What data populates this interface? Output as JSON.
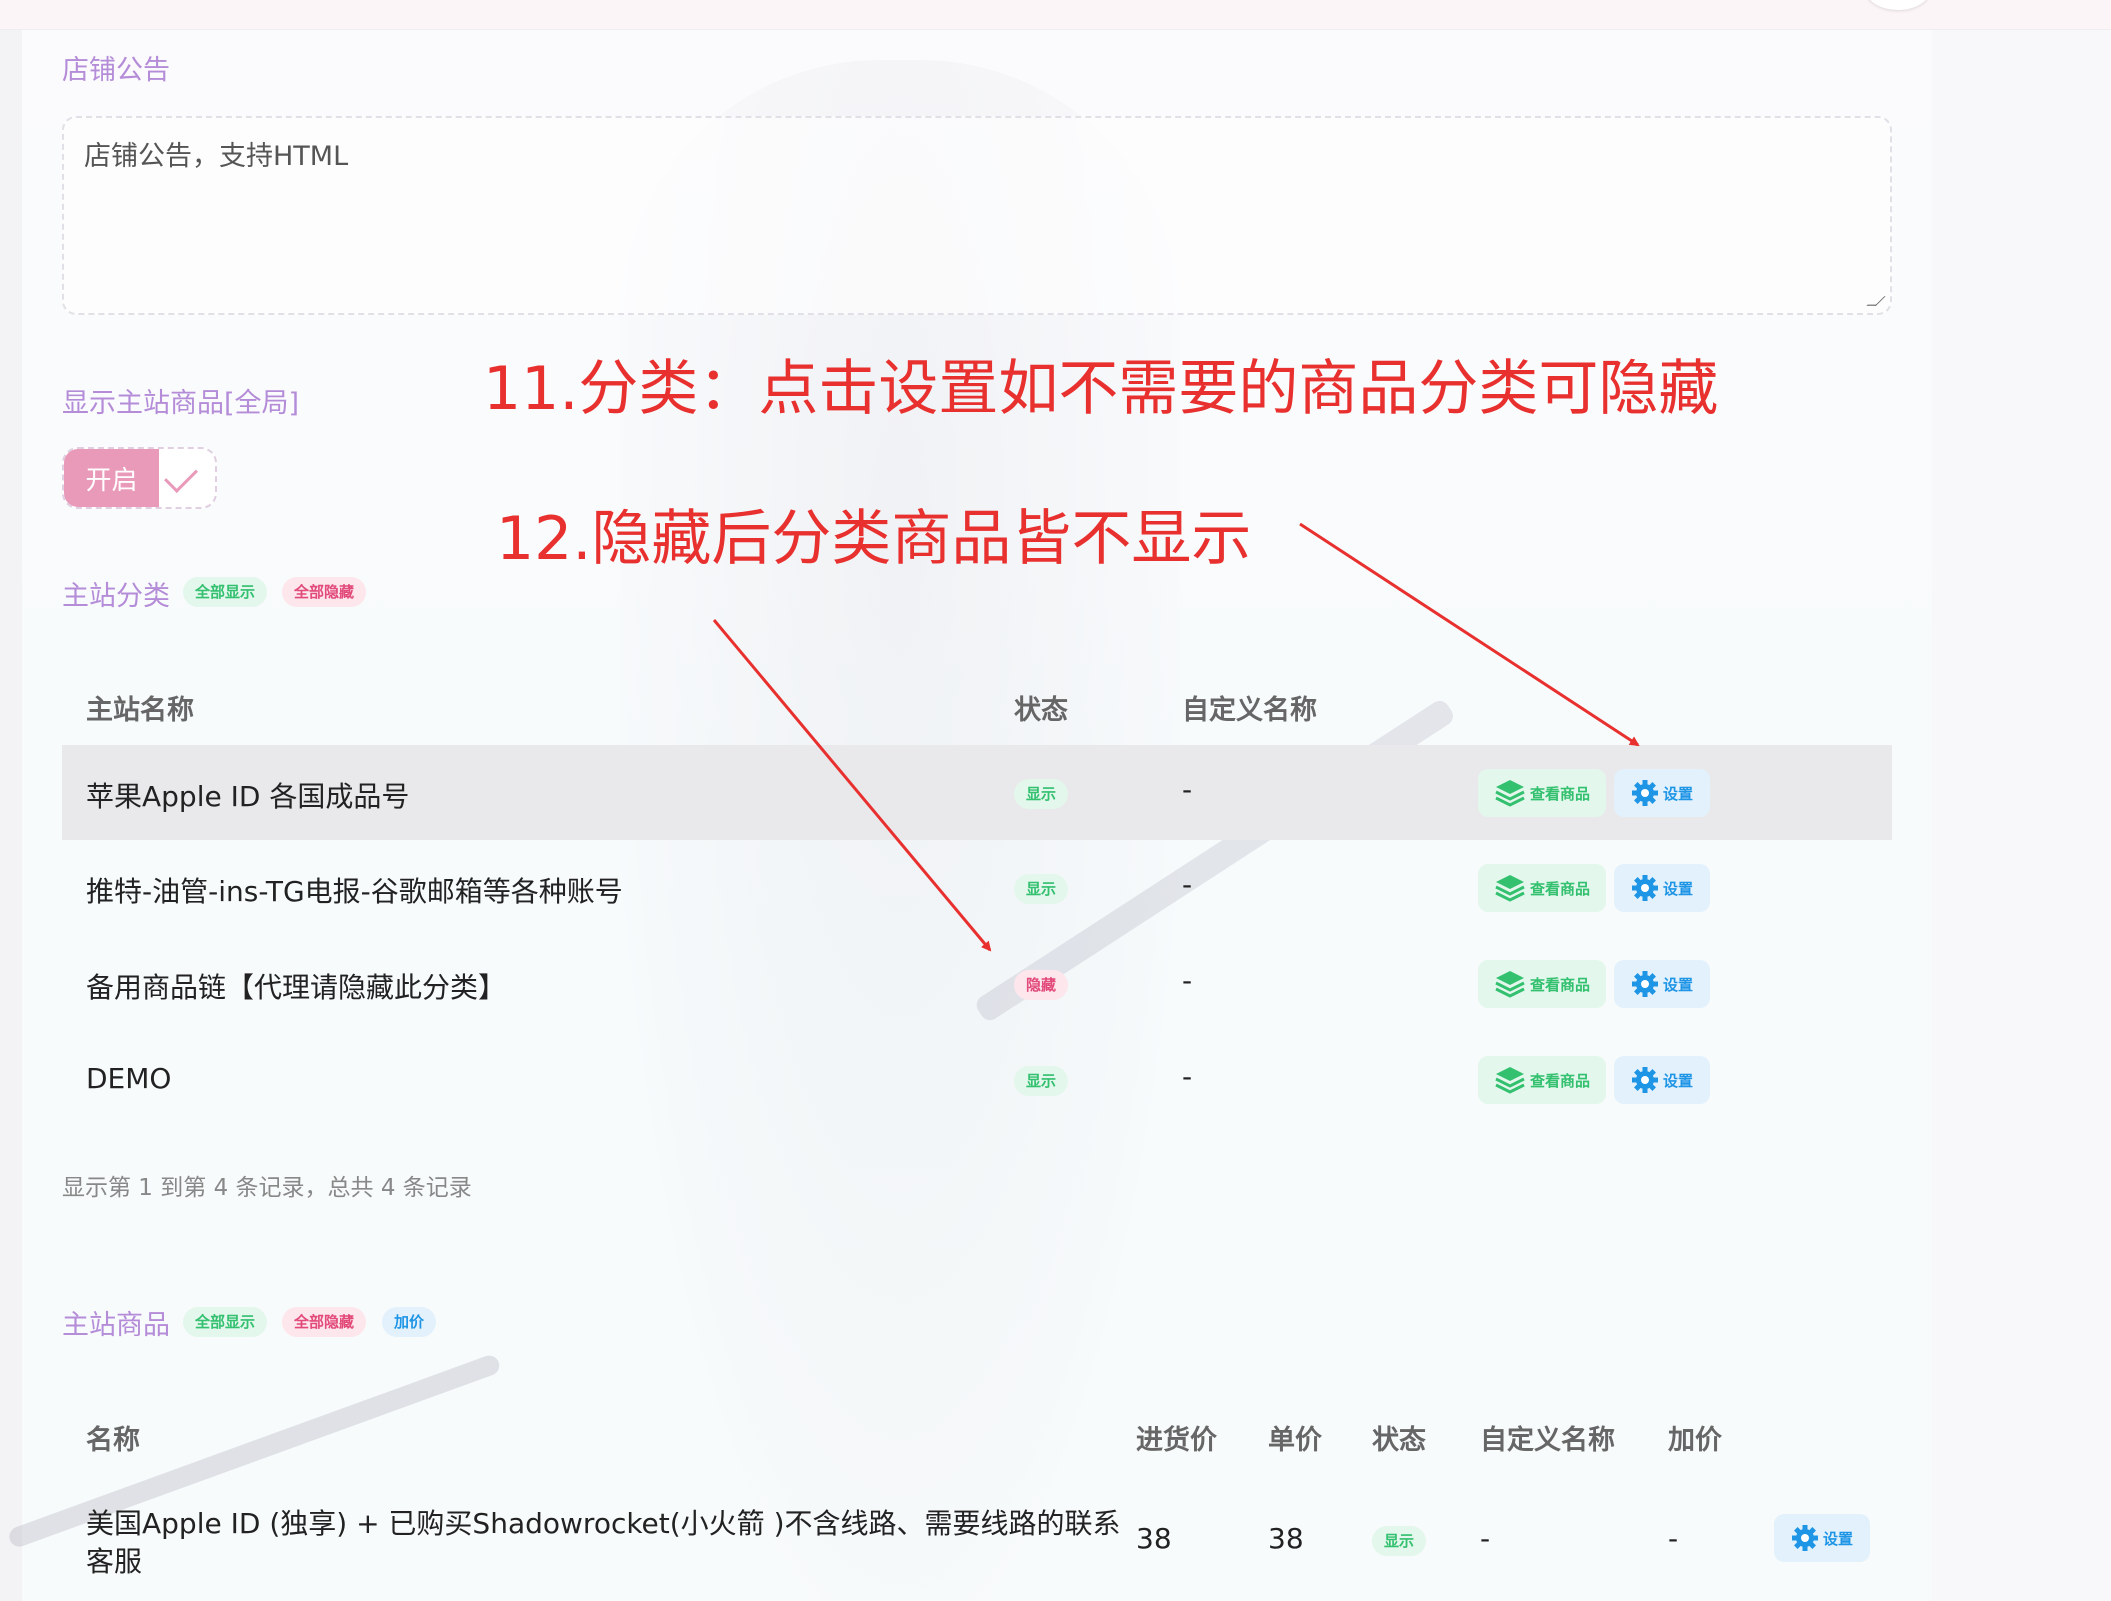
{
  "notice": {
    "label": "店铺公告",
    "placeholder": "店铺公告，支持HTML"
  },
  "global_show": {
    "label": "显示主站商品[全局]",
    "switch_label": "开启"
  },
  "categories": {
    "title": "主站分类",
    "actions": [
      "全部显示",
      "全部隐藏"
    ],
    "columns": [
      "主站名称",
      "状态",
      "自定义名称"
    ],
    "rows": [
      {
        "name": "苹果Apple ID 各国成品号",
        "status": "显示",
        "custom": "-",
        "view": "查看商品",
        "settings": "设置"
      },
      {
        "name": "推特-油管-ins-TG电报-谷歌邮箱等各种账号",
        "status": "显示",
        "custom": "-",
        "view": "查看商品",
        "settings": "设置"
      },
      {
        "name": "备用商品链【代理请隐藏此分类】",
        "status": "隐藏",
        "custom": "-",
        "view": "查看商品",
        "settings": "设置"
      },
      {
        "name": "DEMO",
        "status": "显示",
        "custom": "-",
        "view": "查看商品",
        "settings": "设置"
      }
    ],
    "pagination": "显示第 1 到第 4 条记录，总共 4 条记录"
  },
  "products": {
    "title": "主站商品",
    "actions": [
      "全部显示",
      "全部隐藏",
      "加价"
    ],
    "columns": [
      "名称",
      "进货价",
      "单价",
      "状态",
      "自定义名称",
      "加价"
    ],
    "rows": [
      {
        "name_line1": "美国Apple ID (独享) + 已购买Shadowrocket(小火箭 )不含线路、需要线路的联系",
        "name_line2": "客服",
        "cost": "38",
        "price": "38",
        "status": "显示",
        "custom": "-",
        "markup": "-",
        "settings": "设置"
      }
    ]
  },
  "annotations": {
    "note1": "11.分类：点击设置如不需要的商品分类可隐藏",
    "note2": "12.隐藏后分类商品皆不显示"
  },
  "colors": {
    "label_purple": "#b48cd8",
    "switch_pink": "#e99ab9",
    "green": "#33c06f",
    "pink": "#e24a79",
    "blue": "#1f95e6",
    "annotation_red": "#e8302f"
  },
  "icons": {
    "view": "stack-layers-icon",
    "settings": "gear-icon",
    "switch": "check-icon"
  }
}
